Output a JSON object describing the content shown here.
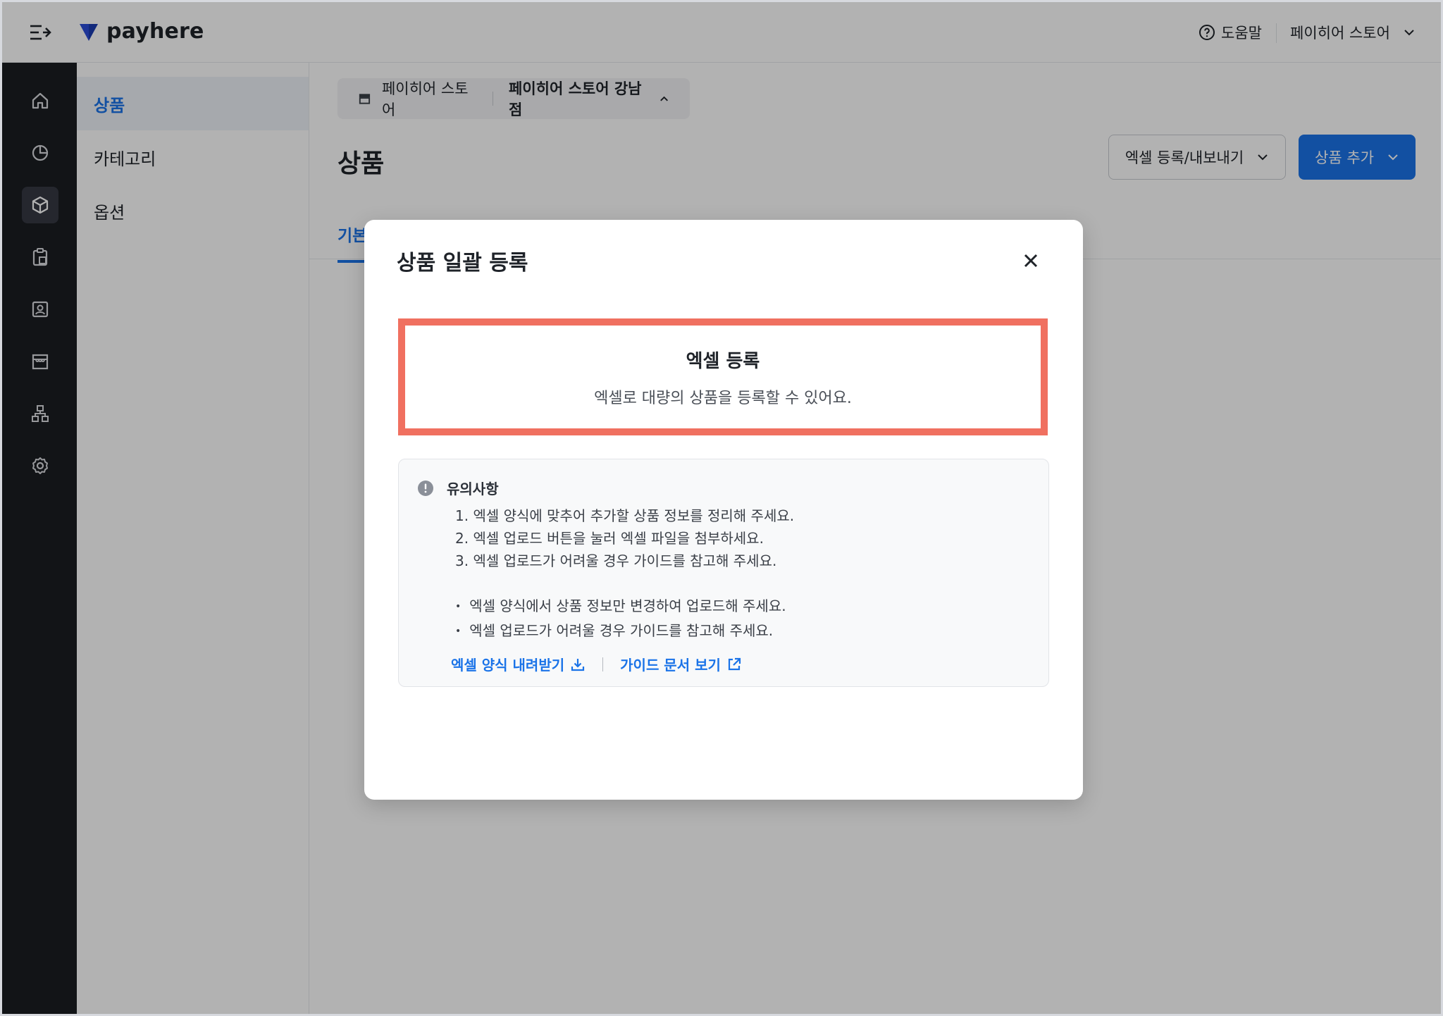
{
  "header": {
    "logo_text": "payhere",
    "help_label": "도움말",
    "store_label": "페이히어 스토어"
  },
  "subnav": {
    "items": [
      {
        "label": "상품"
      },
      {
        "label": "카테고리"
      },
      {
        "label": "옵션"
      }
    ]
  },
  "main": {
    "breadcrumb": {
      "store": "페이히어 스토어",
      "branch": "페이히어 스토어 강남점"
    },
    "page_title": "상품",
    "excel_button_label": "엑셀 등록/내보내기",
    "add_button_label": "상품 추가",
    "tab_label": "기본"
  },
  "modal": {
    "title": "상품 일괄 등록",
    "excel_card": {
      "title": "엑셀 등록",
      "description": "엑셀로 대량의 상품을 등록할 수 있어요."
    },
    "notice": {
      "title": "유의사항",
      "steps": [
        "1. 엑셀 양식에 맞추어 추가할 상품 정보를 정리해 주세요.",
        "2. 엑셀 업로드 버튼을 눌러 엑셀 파일을 첨부하세요.",
        "3. 엑셀 업로드가 어려울 경우 가이드를 참고해 주세요."
      ],
      "bullets": [
        "엑셀 양식에서 상품 정보만 변경하여 업로드해 주세요.",
        "엑셀 업로드가 어려울 경우 가이드를 참고해 주세요."
      ],
      "links": {
        "download_template": "엑셀 양식 내려받기",
        "view_guide": "가이드 문서 보기"
      }
    }
  },
  "colors": {
    "brand_blue": "#1a73e8",
    "highlight_red": "#f07060",
    "rail_bg": "#1b1d22"
  }
}
